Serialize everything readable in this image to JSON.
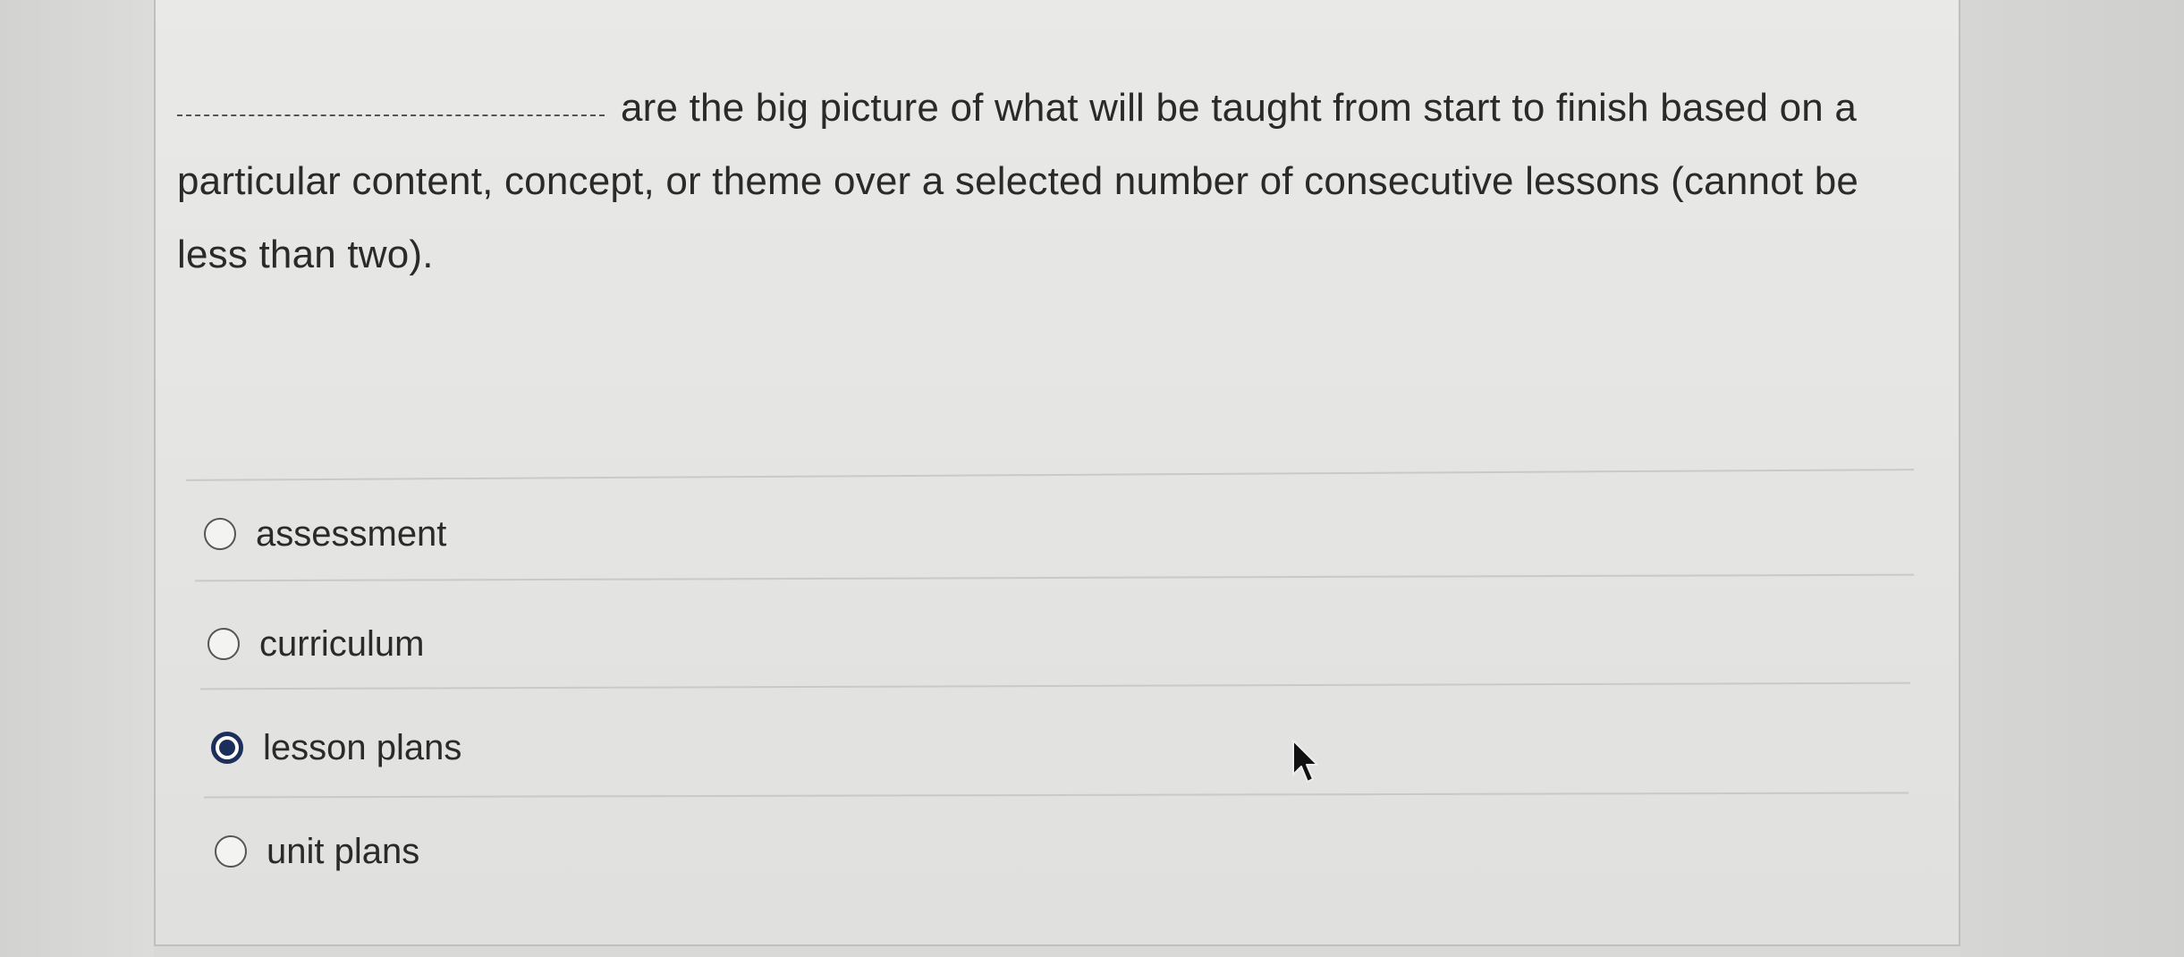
{
  "question": {
    "text": "are the big picture of what will be taught from start to finish based on a particular content, concept, or theme over a selected number of consecutive lessons (cannot be less than two)."
  },
  "options": [
    {
      "label": "assessment",
      "selected": false
    },
    {
      "label": "curriculum",
      "selected": false
    },
    {
      "label": "lesson plans",
      "selected": true
    },
    {
      "label": "unit plans",
      "selected": false
    }
  ],
  "colors": {
    "selected_radio": "#1c2f5a",
    "text": "#2a2a2a"
  },
  "icons": {
    "cursor": "mouse-pointer-arrow"
  }
}
